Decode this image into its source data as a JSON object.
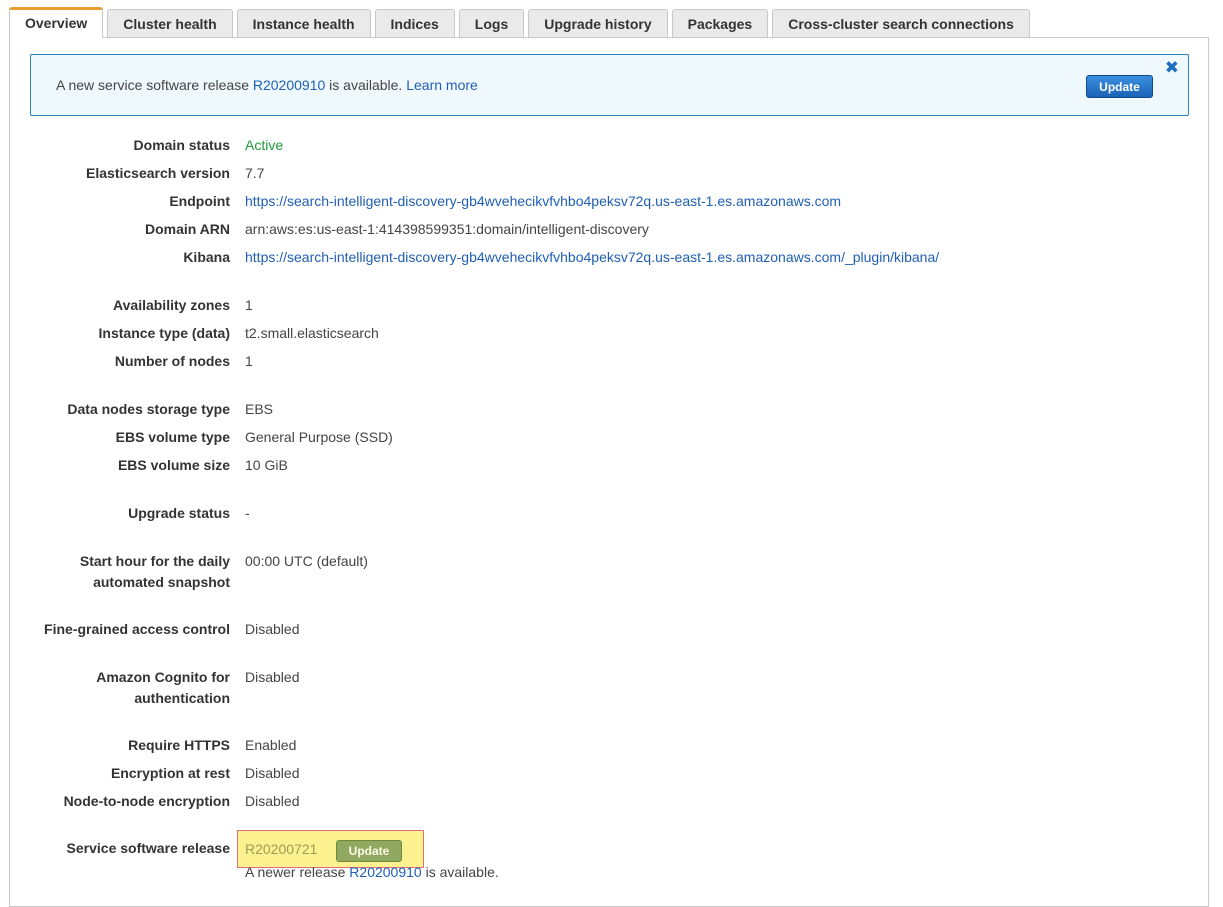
{
  "tabs": [
    {
      "label": "Overview",
      "active": true
    },
    {
      "label": "Cluster health"
    },
    {
      "label": "Instance health"
    },
    {
      "label": "Indices"
    },
    {
      "label": "Logs"
    },
    {
      "label": "Upgrade history"
    },
    {
      "label": "Packages"
    },
    {
      "label": "Cross-cluster search connections"
    }
  ],
  "banner": {
    "text_before": "A new service software release ",
    "release": "R20200910",
    "text_after": " is available. ",
    "learn_more": "Learn more",
    "update_button": "Update",
    "close_icon": "close-icon"
  },
  "details": {
    "domain_status": {
      "label": "Domain status",
      "value": "Active"
    },
    "es_version": {
      "label": "Elasticsearch version",
      "value": "7.7"
    },
    "endpoint": {
      "label": "Endpoint",
      "value": "https://search-intelligent-discovery-gb4wvehecikvfvhbo4peksv72q.us-east-1.es.amazonaws.com"
    },
    "domain_arn": {
      "label": "Domain ARN",
      "value": "arn:aws:es:us-east-1:414398599351:domain/intelligent-discovery"
    },
    "kibana": {
      "label": "Kibana",
      "value": "https://search-intelligent-discovery-gb4wvehecikvfvhbo4peksv72q.us-east-1.es.amazonaws.com/_plugin/kibana/"
    },
    "availability_zones": {
      "label": "Availability zones",
      "value": "1"
    },
    "instance_type": {
      "label": "Instance type (data)",
      "value": "t2.small.elasticsearch"
    },
    "number_of_nodes": {
      "label": "Number of nodes",
      "value": "1"
    },
    "storage_type": {
      "label": "Data nodes storage type",
      "value": "EBS"
    },
    "ebs_volume_type": {
      "label": "EBS volume type",
      "value": "General Purpose (SSD)"
    },
    "ebs_volume_size": {
      "label": "EBS volume size",
      "value": "10 GiB"
    },
    "upgrade_status": {
      "label": "Upgrade status",
      "value": "-"
    },
    "snapshot_hour": {
      "label_line1": "Start hour for the daily",
      "label_line2": "automated snapshot",
      "value": "00:00 UTC (default)"
    },
    "fine_grained": {
      "label": "Fine-grained access control",
      "value": "Disabled"
    },
    "cognito": {
      "label_line1": "Amazon Cognito for",
      "label_line2": "authentication",
      "value": "Disabled"
    },
    "require_https": {
      "label": "Require HTTPS",
      "value": "Enabled"
    },
    "encryption_at_rest": {
      "label": "Encryption at rest",
      "value": "Disabled"
    },
    "node_to_node": {
      "label": "Node-to-node encryption",
      "value": "Disabled"
    },
    "service_release": {
      "label": "Service software release",
      "value": "R20200721",
      "update_button": "Update",
      "newer_before": "A newer release ",
      "newer_release": "R20200910",
      "newer_after": " is available."
    }
  },
  "colors": {
    "active_tab_accent": "#e7a02f",
    "link": "#1f5fb5",
    "status_active": "#1d9a36",
    "banner_border": "#2a82c1",
    "highlight": "#fbf28f"
  }
}
